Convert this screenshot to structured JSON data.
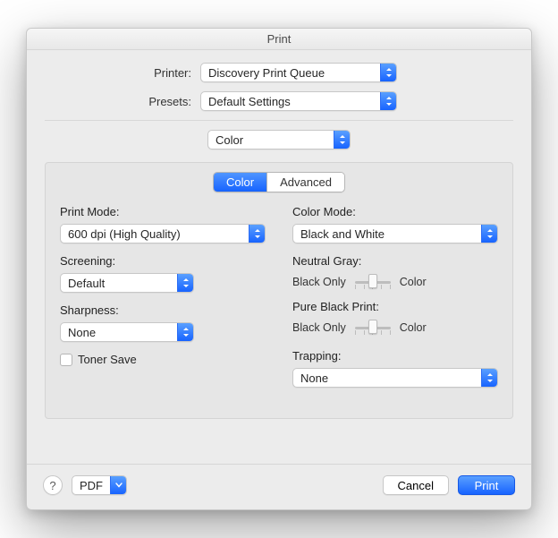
{
  "window": {
    "title": "Print"
  },
  "top": {
    "printer_label": "Printer:",
    "printer_value": "Discovery Print Queue",
    "presets_label": "Presets:",
    "presets_value": "Default Settings",
    "section_value": "Color"
  },
  "tabs": {
    "color": "Color",
    "advanced": "Advanced"
  },
  "left": {
    "print_mode_label": "Print Mode:",
    "print_mode_value": "600 dpi (High Quality)",
    "screening_label": "Screening:",
    "screening_value": "Default",
    "sharpness_label": "Sharpness:",
    "sharpness_value": "None",
    "toner_save_label": "Toner Save"
  },
  "right": {
    "color_mode_label": "Color Mode:",
    "color_mode_value": "Black and White",
    "neutral_gray_label": "Neutral Gray:",
    "slider_left": "Black Only",
    "slider_right": "Color",
    "pure_black_label": "Pure Black Print:",
    "trapping_label": "Trapping:",
    "trapping_value": "None"
  },
  "footer": {
    "pdf_label": "PDF",
    "cancel": "Cancel",
    "print": "Print"
  }
}
